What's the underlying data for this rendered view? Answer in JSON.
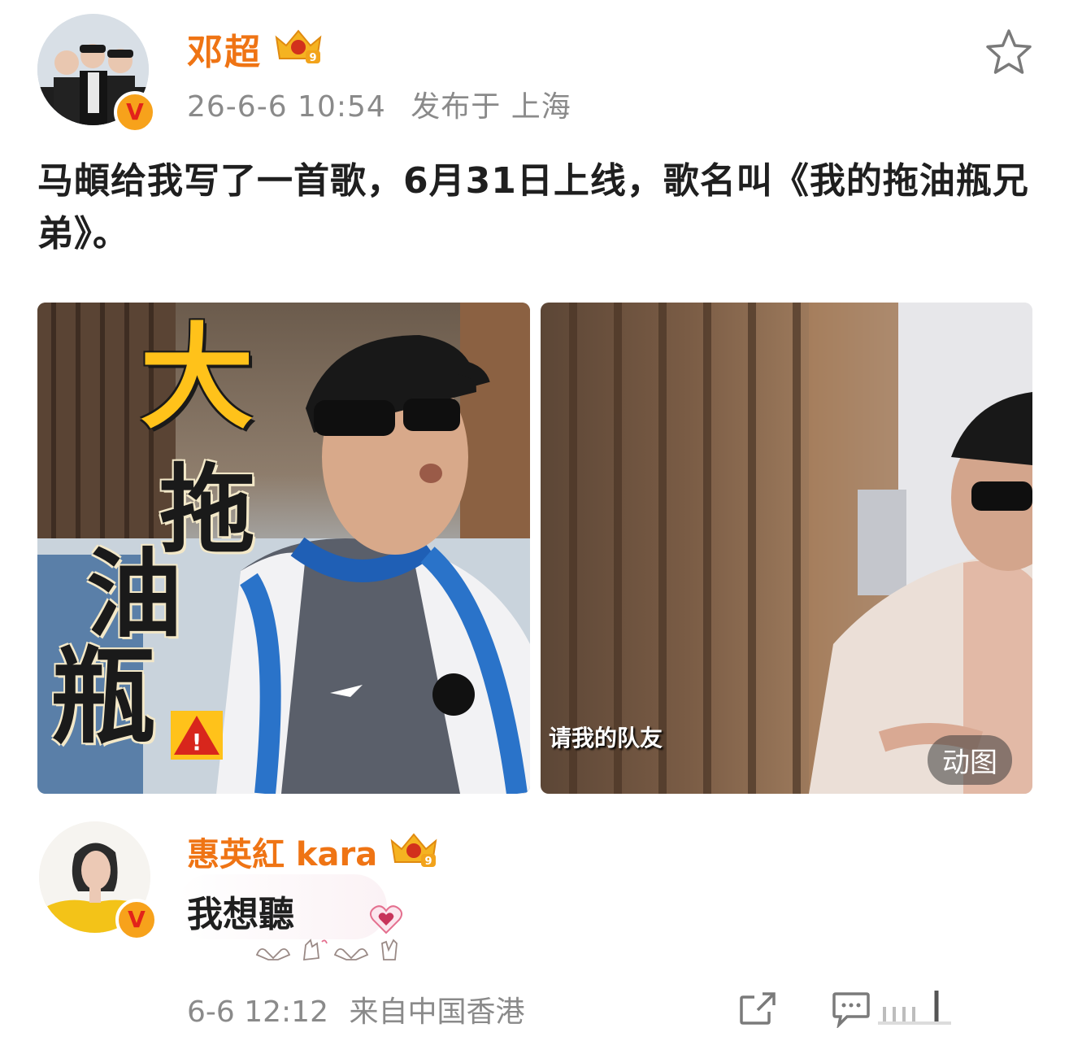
{
  "post": {
    "author": "邓超",
    "level": "9",
    "timestamp": "26-6-6 10:54",
    "location": "发布于 上海",
    "text": "马頔给我写了一首歌，6月31日上线，歌名叫《我的拖油瓶兄弟》。",
    "images": {
      "left": {
        "overlay_big": "大",
        "overlay_2": "拖",
        "overlay_3": "油",
        "overlay_4": "瓶"
      },
      "right": {
        "caption": "请我的队友",
        "badge": "动图"
      }
    },
    "icons": [
      "star-icon",
      "verified-icon",
      "crown-icon"
    ]
  },
  "comment": {
    "author": "惠英紅 kara",
    "level": "9",
    "text": "我想聽",
    "emoji_icons": [
      "heart-hands-icon",
      "finger-heart-icon",
      "heart-icon",
      "rock-hand-icon"
    ],
    "timestamp": "6-6 12:12",
    "source": "来自中国香港",
    "icons": [
      "share-icon",
      "comment-icon",
      "like-icon"
    ]
  },
  "colors": {
    "name_orange": "#ef7414",
    "meta_gray": "#8a8a8a",
    "badge_gold": "#f7a21b",
    "overlay_yellow": "#ffc21a"
  }
}
